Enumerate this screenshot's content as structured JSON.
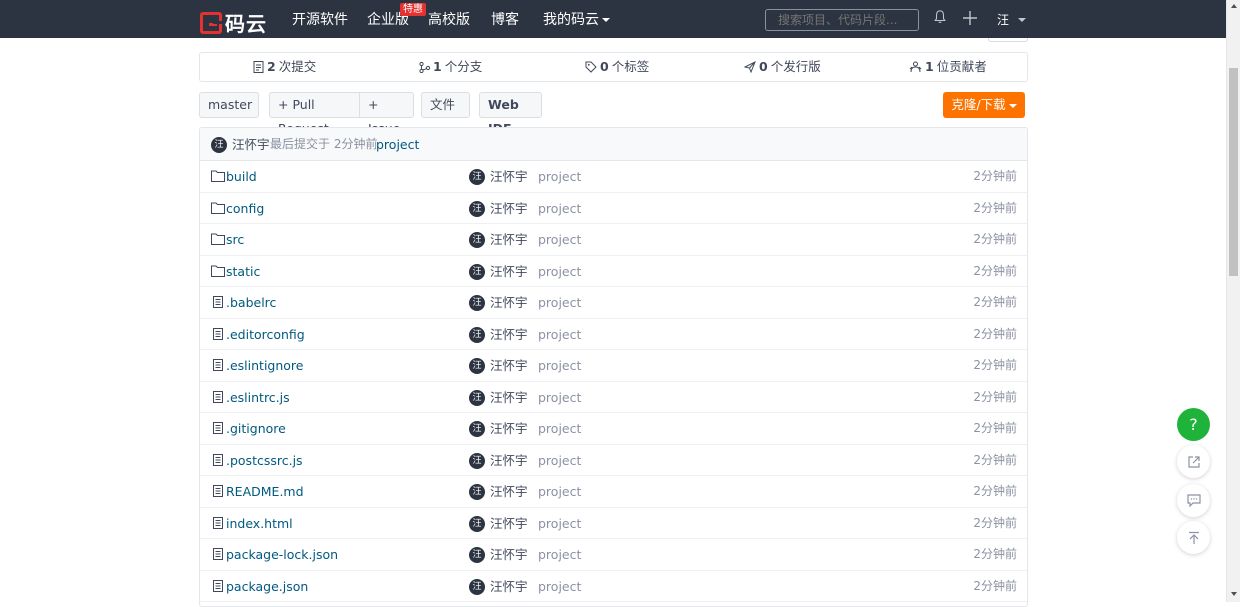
{
  "navbar": {
    "logo_text": "码云",
    "links": {
      "open_source": "开源软件",
      "enterprise": "企业版",
      "enterprise_badge": "特惠",
      "university": "高校版",
      "blog": "博客",
      "my_gitee": "我的码云"
    },
    "search_placeholder": "搜索项目、代码片段...",
    "avatar_text": "汪"
  },
  "stats": {
    "commits": {
      "count": "2",
      "label": "次提交"
    },
    "branches": {
      "count": "1",
      "label": "个分支"
    },
    "tags": {
      "count": "0",
      "label": "个标签"
    },
    "releases": {
      "count": "0",
      "label": "个发行版"
    },
    "contributors": {
      "count": "1",
      "label": "位贡献者"
    }
  },
  "toolbar": {
    "branch": "master",
    "pull_request": "+ Pull Request",
    "issue": "+ Issue",
    "file": "文件",
    "web_ide": "Web IDE",
    "clone": "克隆/下载"
  },
  "last_commit": {
    "avatar": "汪",
    "user": "汪怀宇",
    "meta": "最后提交于 2分钟前",
    "message": "project"
  },
  "files": [
    {
      "type": "folder",
      "name": "build",
      "avatar": "汪",
      "user": "汪怀宇",
      "message": "project",
      "time": "2分钟前"
    },
    {
      "type": "folder",
      "name": "config",
      "avatar": "汪",
      "user": "汪怀宇",
      "message": "project",
      "time": "2分钟前"
    },
    {
      "type": "folder",
      "name": "src",
      "avatar": "汪",
      "user": "汪怀宇",
      "message": "project",
      "time": "2分钟前"
    },
    {
      "type": "folder",
      "name": "static",
      "avatar": "汪",
      "user": "汪怀宇",
      "message": "project",
      "time": "2分钟前"
    },
    {
      "type": "file",
      "name": ".babelrc",
      "avatar": "汪",
      "user": "汪怀宇",
      "message": "project",
      "time": "2分钟前"
    },
    {
      "type": "file",
      "name": ".editorconfig",
      "avatar": "汪",
      "user": "汪怀宇",
      "message": "project",
      "time": "2分钟前"
    },
    {
      "type": "file",
      "name": ".eslintignore",
      "avatar": "汪",
      "user": "汪怀宇",
      "message": "project",
      "time": "2分钟前"
    },
    {
      "type": "file",
      "name": ".eslintrc.js",
      "avatar": "汪",
      "user": "汪怀宇",
      "message": "project",
      "time": "2分钟前"
    },
    {
      "type": "file",
      "name": ".gitignore",
      "avatar": "汪",
      "user": "汪怀宇",
      "message": "project",
      "time": "2分钟前"
    },
    {
      "type": "file",
      "name": ".postcssrc.js",
      "avatar": "汪",
      "user": "汪怀宇",
      "message": "project",
      "time": "2分钟前"
    },
    {
      "type": "file",
      "name": "README.md",
      "avatar": "汪",
      "user": "汪怀宇",
      "message": "project",
      "time": "2分钟前"
    },
    {
      "type": "file",
      "name": "index.html",
      "avatar": "汪",
      "user": "汪怀宇",
      "message": "project",
      "time": "2分钟前"
    },
    {
      "type": "file",
      "name": "package-lock.json",
      "avatar": "汪",
      "user": "汪怀宇",
      "message": "project",
      "time": "2分钟前"
    },
    {
      "type": "file",
      "name": "package.json",
      "avatar": "汪",
      "user": "汪怀宇",
      "message": "project",
      "time": "2分钟前"
    }
  ],
  "float_actions": {
    "help": "?",
    "icons": [
      "share-icon",
      "comment-icon",
      "back-to-top-icon"
    ]
  },
  "colors": {
    "navbar_bg": "#2b3440",
    "brand_red": "#e5312f",
    "clone_orange": "#fe7300",
    "link_blue": "#005980",
    "help_green": "#1fb33b"
  }
}
